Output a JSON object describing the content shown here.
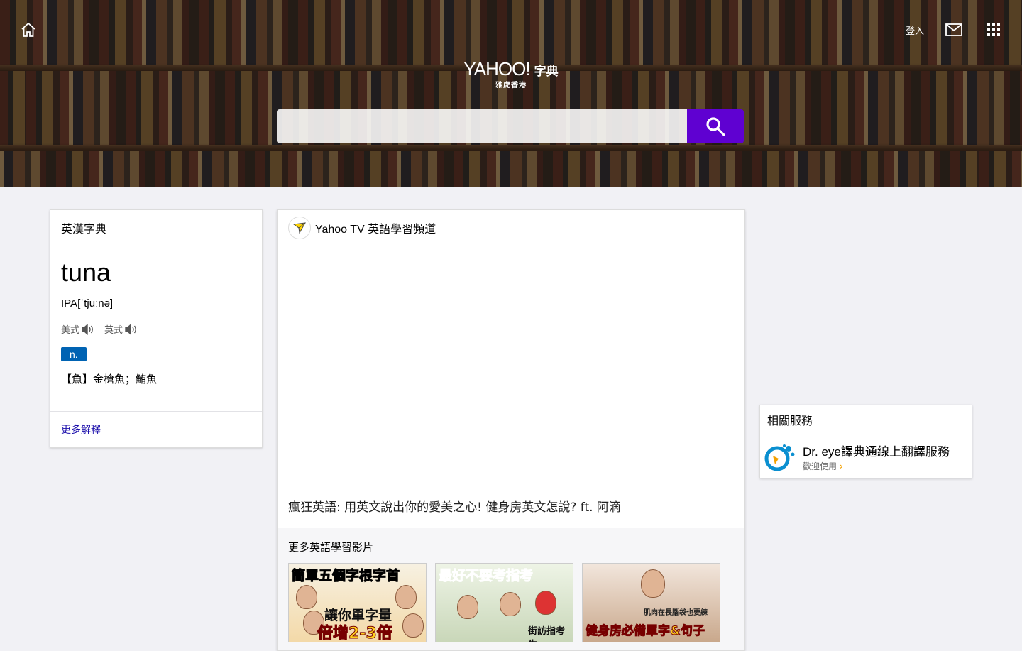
{
  "header": {
    "home_icon": "home-icon",
    "login_label": "登入",
    "mail_icon": "mail-icon",
    "apps_icon": "apps-grid-icon",
    "logo": {
      "yahoo": "YAHOO!",
      "product": "字典",
      "sub": "雅虎香港"
    },
    "search": {
      "value": "",
      "placeholder": "",
      "button_icon": "search-icon"
    }
  },
  "word_card": {
    "heading": "英漢字典",
    "word": "tuna",
    "ipa": "IPA[ˈtjuːnə]",
    "pronunciations": [
      {
        "label": "美式",
        "icon": "speaker-icon"
      },
      {
        "label": "英式",
        "icon": "speaker-icon"
      }
    ],
    "pos": "n.",
    "definition": "【魚】金槍魚；鮪魚",
    "more_link": "更多解釋"
  },
  "video_card": {
    "channel": "Yahoo TV 英語學習頻道",
    "caption": "瘋狂英語: 用英文說出你的愛美之心! 健身房英文怎說? ft. 阿滴",
    "related_heading": "更多英語學習影片",
    "thumbnails": [
      {
        "top_text": "簡單五個字根字首",
        "mid_text": "讓你單字量",
        "bottom_text": "倍增2-3倍"
      },
      {
        "top_text": "最好不要考指考",
        "mid_text": "",
        "bottom_text": "街訪指考生"
      },
      {
        "top_text": "",
        "mid_text": "肌肉在長腦袋也要練",
        "bottom_text": "健身房必備單字&句子"
      }
    ]
  },
  "service_card": {
    "heading": "相關服務",
    "name": "Dr. eye譯典通線上翻譯服務",
    "sub": "歡迎使用"
  },
  "colors": {
    "accent": "#5f01d1",
    "pos_tag": "#0063b3",
    "link": "#1a0dab"
  }
}
